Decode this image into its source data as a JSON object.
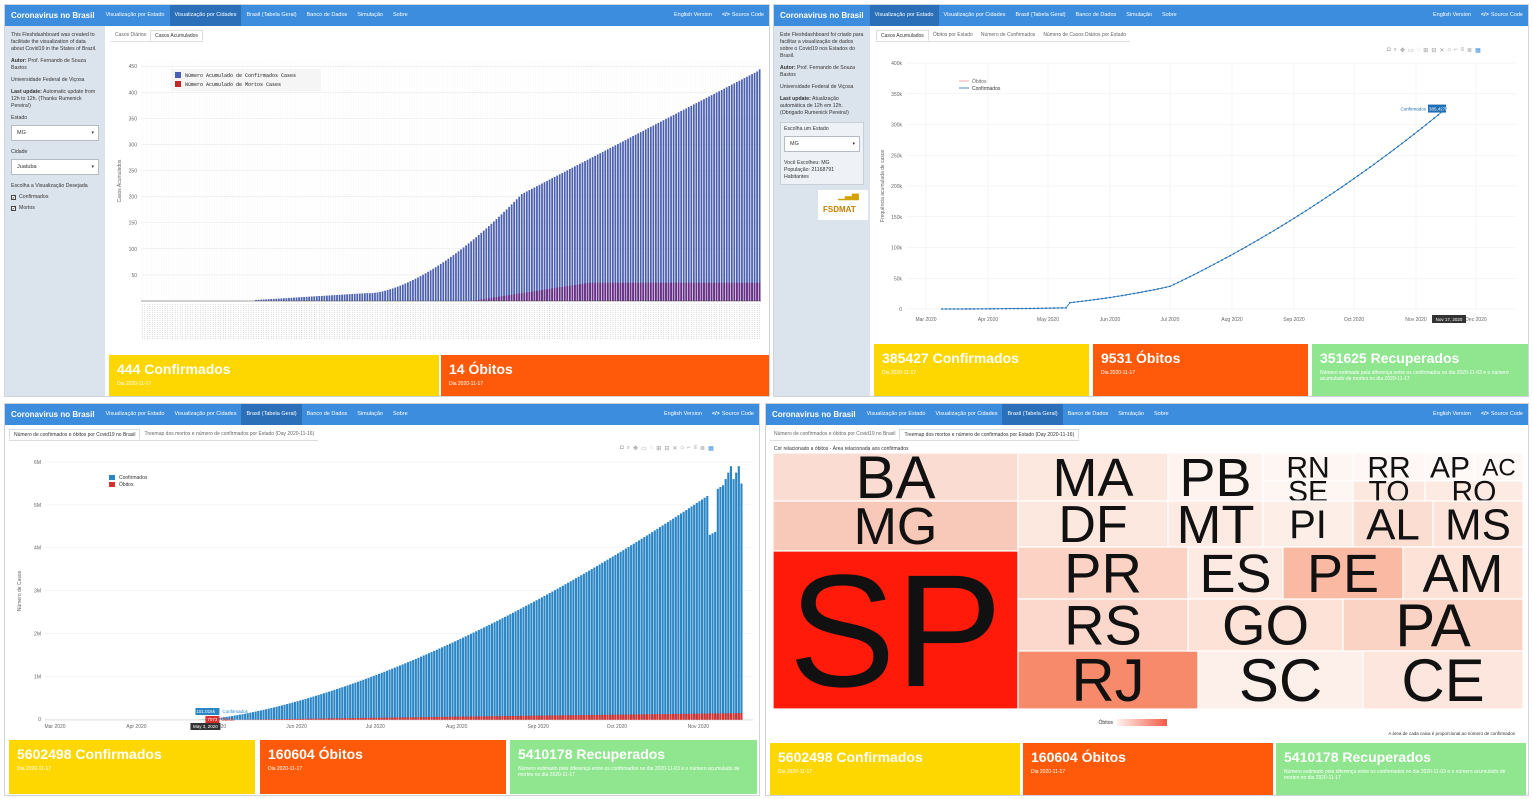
{
  "nav": {
    "brand": "Coronavirus no Brasil",
    "items": [
      "Visualização por Estado",
      "Visualização por Cidades",
      "Brasil (Tabela Geral)",
      "Banco de Dados",
      "Simulação",
      "Sobre"
    ],
    "english": "English Version",
    "source": "Source Code"
  },
  "p1": {
    "sidebar": {
      "intro": "This Fleshdashboard was created to facilitate the visualization of data about Covid19 in the States of Brazil.",
      "author_label": "Autor:",
      "author": "Prof. Fernando de Souza Bastos",
      "university": "Universidade Federal de Viçosa",
      "update_label": "Last update:",
      "update": "Automatic update from 12h to 12h. (Thanks Rumenick Pereira!)",
      "estado_label": "Estado",
      "estado_value": "MG",
      "cidade_label": "Cidade",
      "cidade_value": "Juatuba",
      "vis_label": "Escolha a Visualização Desejada",
      "check1": "Confirmados",
      "check2": "Mortos"
    },
    "tabs": [
      "Casos Diários",
      "Casos Acumulados"
    ],
    "legend1": "Número Acumulado de Confirmados Cases",
    "legend2": "Número Acumulado de Mortos Cases",
    "ylabel": "Casos Acumulados",
    "yticks": [
      "450",
      "400",
      "350",
      "300",
      "250",
      "200",
      "150",
      "100",
      "50"
    ],
    "box1": {
      "value": "444 Confirmados",
      "date": "Dia 2020-11-17"
    },
    "box2": {
      "value": "14 Óbitos",
      "date": "Dia 2020-11-17"
    }
  },
  "p2": {
    "sidebar": {
      "intro": "Este Fleshdashboard foi criado para facilitar a visualização de dados sobre o Covid19 nos Estados do Brasil.",
      "author_label": "Autor:",
      "author": "Prof. Fernando de Souza Bastos",
      "university": "Universidade Federal de Viçosa",
      "update_label": "Last update:",
      "update": "Atualização automática de 12h em 12h. (Obrigado Rumenick Pereira!)",
      "estado_label": "Escolha um Estado",
      "estado_value": "MG",
      "chosen": "Você Escolheu: MG",
      "population": "População: 21168791 Habitantes",
      "logo": "FSDMAT"
    },
    "tabs": [
      "Casos Acumulados",
      "Óbitos por Estado",
      "Número de Confirmados",
      "Número de Casos Diários por Estado"
    ],
    "legend1": "Óbitos",
    "legend2": "Confirmados",
    "ylabel": "Frequência acumulada de casos",
    "yticks": [
      "400k",
      "350k",
      "300k",
      "250k",
      "200k",
      "150k",
      "100k",
      "50k",
      "0"
    ],
    "xticks": [
      "Mar 2020",
      "Apr 2020",
      "May 2020",
      "Jun 2020",
      "Jul 2020",
      "Aug 2020",
      "Sep 2020",
      "Oct 2020",
      "Nov 2020",
      "Dec 2020"
    ],
    "hover_label": "Confirmados",
    "hover_value": "385,427k",
    "hover_date": "Nov 17, 2020",
    "box1": {
      "value": "385427 Confirmados",
      "date": "Dia 2020-11-17"
    },
    "box2": {
      "value": "9531 Óbitos",
      "date": "Dia 2020-11-17"
    },
    "box3": {
      "value": "351625 Recuperados",
      "date": "Número estimado pela diferença entre os confirmados no dia 2020-11-03 e o número acumulado de mortes no dia 2020-11-17"
    }
  },
  "p3": {
    "tabs": [
      "Número de confirmados e óbitos por Covid19 no Brasil",
      "Treemap dos mortos e número de confirmados por Estado (Day 2020-11-16)"
    ],
    "legend1": "Confirmados",
    "legend2": "Óbitos",
    "ylabel": "Número de Casos",
    "yticks": [
      "6M",
      "5M",
      "4M",
      "3M",
      "2M",
      "1M",
      "0"
    ],
    "xticks": [
      "Mar 2020",
      "Apr 2020",
      "May 2020",
      "Jun 2020",
      "Jul 2020",
      "Aug 2020",
      "Sep 2020",
      "Oct 2020",
      "Nov 2020"
    ],
    "hover1_value": "101.016k",
    "hover1_label": "Confirmados",
    "hover2_value": "7073",
    "hover2_label": "Óbitos",
    "hover_date": "May 3, 2020",
    "box1": {
      "value": "5602498 Confirmados",
      "date": "Dia 2020-11-17"
    },
    "box2": {
      "value": "160604 Óbitos",
      "date": "Dia 2020-11-17"
    },
    "box3": {
      "value": "5410178 Recuperados",
      "date": "Número estimado pela diferença entre os confirmados no dia 2020-11-03 e o número acumulado de mortes no dia 2020-11-17"
    }
  },
  "p4": {
    "tabs": [
      "Número de confirmados e óbitos por Covid19 no Brasil",
      "Treemap dos mortos e número de confirmados por Estado (Day 2020-11-16)"
    ],
    "subtitle": "Cor relacionado a óbitos - Área relacionada aos confirmados",
    "states": [
      "BA",
      "MG",
      "SP",
      "MA",
      "DF",
      "PR",
      "RS",
      "RJ",
      "PB",
      "MT",
      "ES",
      "GO",
      "SC",
      "RN",
      "SE",
      "PI",
      "RR",
      "TO",
      "AP",
      "AC",
      "RO",
      "AL",
      "MS",
      "PE",
      "AM",
      "PA",
      "CE"
    ],
    "legend_label": "Óbitos",
    "footnote": "A área de cada caixa é proporcional ao número de confirmados",
    "box1": {
      "value": "5602498 Confirmados",
      "date": "Dia 2020-11-17"
    },
    "box2": {
      "value": "160604 Óbitos",
      "date": "Dia 2020-11-17"
    },
    "box3": {
      "value": "5410178 Recuperados",
      "date": "Número estimado pela diferença entre os confirmados no dia 2020-11-03 e o número acumulado de mortes no dia 2020-11-17"
    }
  },
  "colors": {
    "navbar": "#3c8dde",
    "confirmed": "#2b7bba",
    "deaths": "#d9302c",
    "yellow": "#ffd700",
    "orange": "#ff5a0a",
    "green": "#8fe68f",
    "sp_red": "#ff0000"
  }
}
